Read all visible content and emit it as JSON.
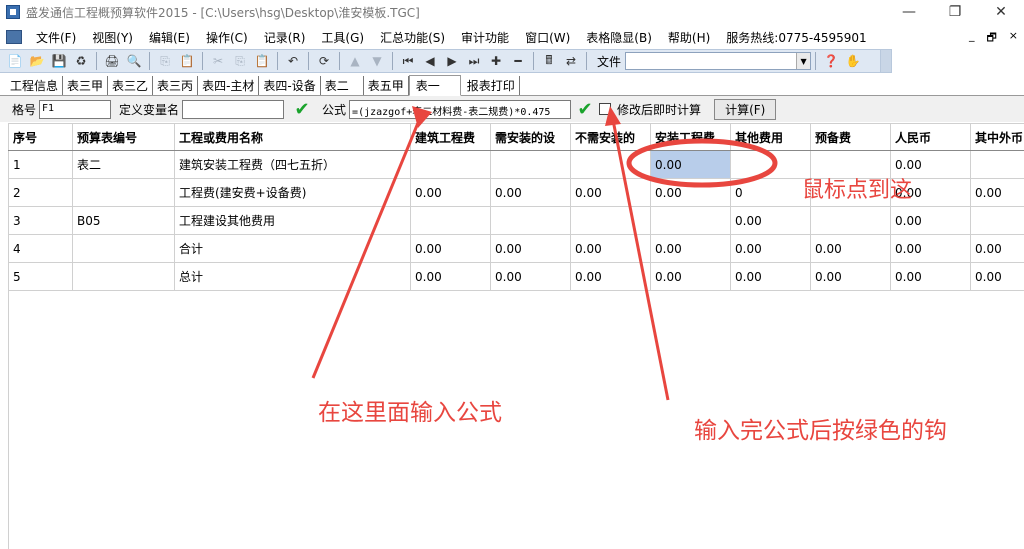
{
  "window": {
    "title": "盛发通信工程概预算软件2015 - [C:\\Users\\hsg\\Desktop\\淮安模板.TGC]",
    "minimize": "—",
    "restore": "❐",
    "close": "✕"
  },
  "menu": {
    "items": [
      "文件(F)",
      "视图(Y)",
      "编辑(E)",
      "操作(C)",
      "记录(R)",
      "工具(G)",
      "汇总功能(S)",
      "审计功能",
      "窗口(W)",
      "表格隐显(B)",
      "帮助(H)",
      "服务热线:0775-4595901"
    ],
    "mdi_minimize": "_",
    "mdi_restore": "🗗",
    "mdi_close": "×"
  },
  "toolbar": {
    "file_label": "文件",
    "file_value": ""
  },
  "tabs": [
    "工程信息",
    "表三甲",
    "表三乙",
    "表三丙",
    "表四-主材",
    "表四-设备",
    "表二",
    "表五甲",
    "表一",
    "报表打印"
  ],
  "active_tab": "表一",
  "formula_row": {
    "cell_label": "格号",
    "cell_value": "F1",
    "var_label": "定义变量名",
    "var_value": "",
    "formula_label": "公式",
    "formula_value": "=(jzazgof+表二材料费-表二规费)*0.475",
    "checkbox_label": "修改后即时计算",
    "calc_button": "计算(F)"
  },
  "table": {
    "columns": [
      "序号",
      "预算表编号",
      "工程或费用名称",
      "建筑工程费",
      "需安装的设",
      "不需安装的",
      "安装工程费",
      "其他费用",
      "预备费",
      "人民币",
      "其中外币"
    ],
    "rows": [
      [
        "1",
        "表二",
        "建筑安装工程费（四七五折）",
        "",
        "",
        "",
        "0.00",
        "",
        "",
        "0.00",
        ""
      ],
      [
        "2",
        "",
        "工程费(建安费+设备费)",
        "0.00",
        "0.00",
        "0.00",
        "0.00",
        "0",
        "",
        "0.00",
        "0.00"
      ],
      [
        "3",
        "B05",
        "工程建设其他费用",
        "",
        "",
        "",
        "",
        "0.00",
        "",
        "0.00",
        ""
      ],
      [
        "4",
        "",
        "合计",
        "0.00",
        "0.00",
        "0.00",
        "0.00",
        "0.00",
        "0.00",
        "0.00",
        "0.00"
      ],
      [
        "5",
        "",
        "总计",
        "0.00",
        "0.00",
        "0.00",
        "0.00",
        "0.00",
        "0.00",
        "0.00",
        "0.00"
      ]
    ]
  },
  "annotations": {
    "click_here": "鼠标点到这",
    "enter_formula": "在这里面输入公式",
    "press_check": "输入完公式后按绿色的钩"
  },
  "colors": {
    "annotation_red": "#e8463f",
    "selected_cell": "#b8cdea",
    "check_green": "#1aa32c"
  }
}
